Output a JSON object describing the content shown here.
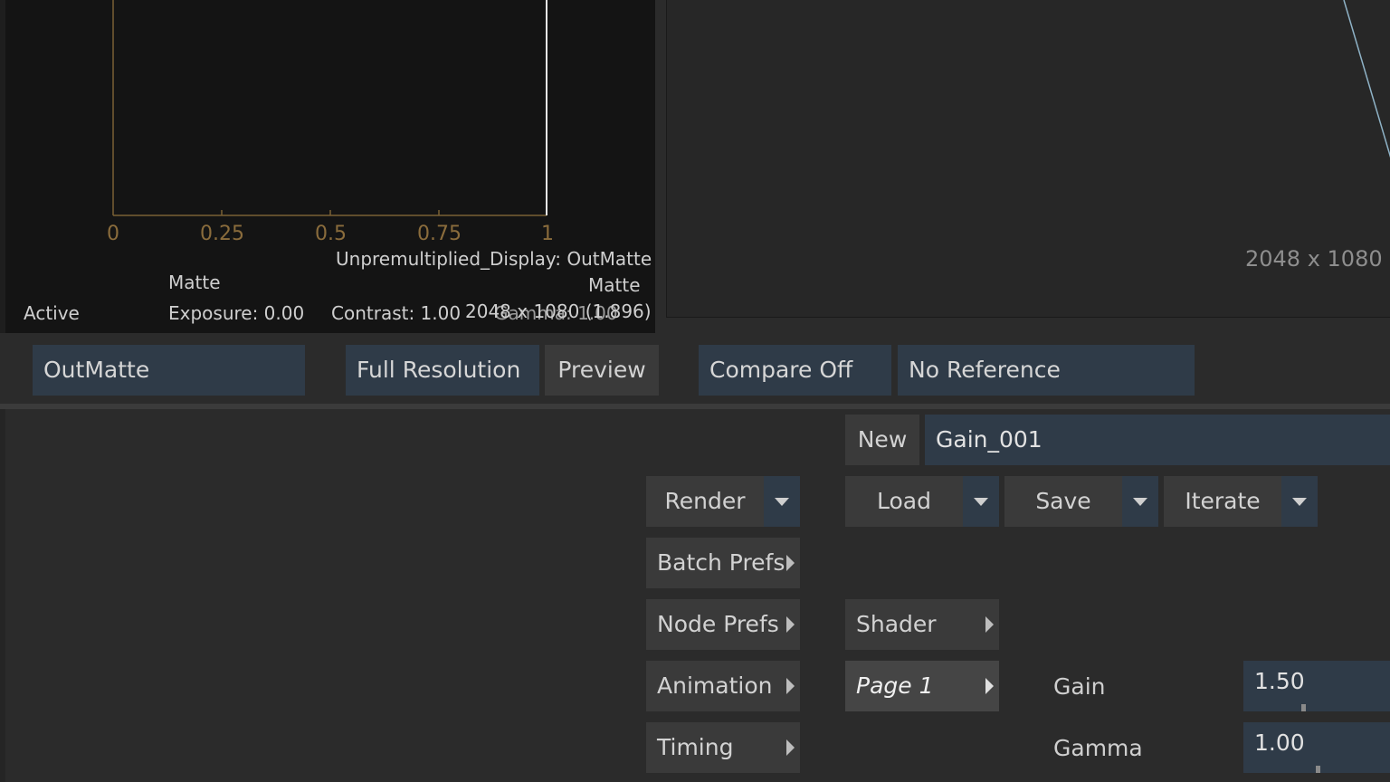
{
  "histogram": {
    "ticks": [
      "0",
      "0.25",
      "0.5",
      "0.75",
      "1"
    ],
    "display_label": "Unpremultiplied_Display: OutMatte",
    "matte_right": "Matte",
    "matte_left": "Matte",
    "status": "Active",
    "exposure": "Exposure: 0.00",
    "contrast": "Contrast: 1.00",
    "gamma": "Gamma: 1.00",
    "resolution": "2048 x 1080 (1.896)"
  },
  "viewer_right": {
    "resolution": "2048 x 1080 ("
  },
  "viewer_controls": {
    "output": "OutMatte",
    "resolution_mode": "Full Resolution",
    "preview": "Preview",
    "compare": "Compare Off",
    "reference": "No Reference"
  },
  "node": {
    "new_label": "New",
    "name": "Gain_001"
  },
  "actions": {
    "render": "Render",
    "load": "Load",
    "save": "Save",
    "iterate": "Iterate",
    "batch_prefs": "Batch Prefs",
    "node_prefs": "Node Prefs",
    "animation": "Animation",
    "timing": "Timing",
    "shader": "Shader",
    "page": "Page 1"
  },
  "params": {
    "gain_label": "Gain",
    "gain_value": "1.50",
    "gamma_label": "Gamma",
    "gamma_value": "1.00"
  }
}
